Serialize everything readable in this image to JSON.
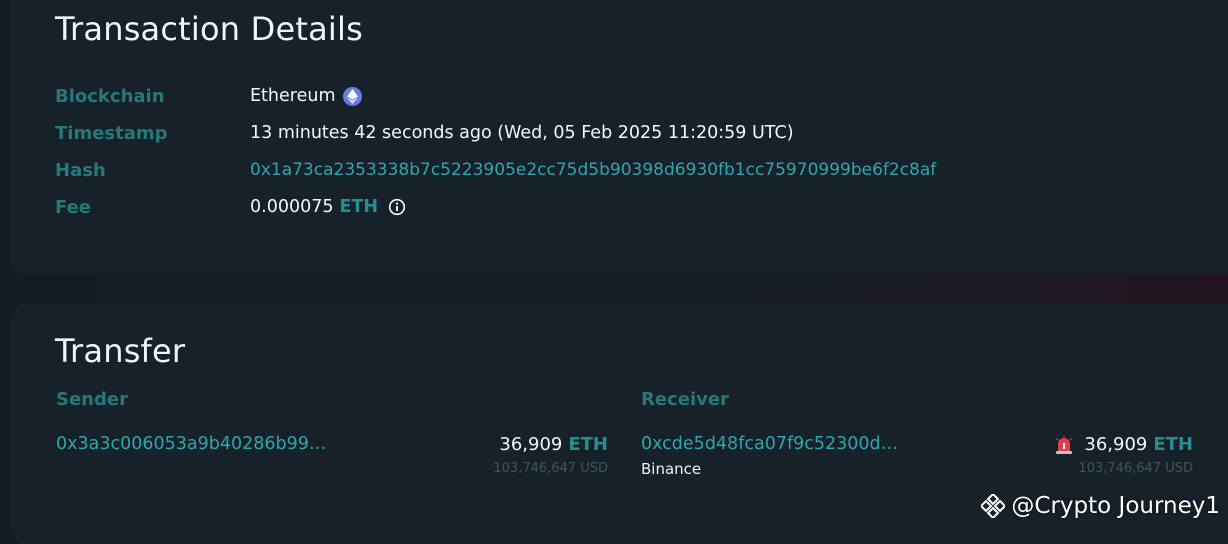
{
  "details": {
    "title": "Transaction Details",
    "rows": {
      "blockchain": {
        "label": "Blockchain",
        "value": "Ethereum",
        "icon": "ethereum-icon"
      },
      "timestamp": {
        "label": "Timestamp",
        "value": "13 minutes 42 seconds ago (Wed, 05 Feb 2025 11:20:59 UTC)"
      },
      "hash": {
        "label": "Hash",
        "value": "0x1a73ca2353338b7c5223905e2cc75d5b90398d6930fb1cc75970999be6f2c8af"
      },
      "fee": {
        "label": "Fee",
        "amount": "0.000075",
        "unit": "ETH",
        "icon": "info-icon"
      }
    }
  },
  "transfer": {
    "title": "Transfer",
    "sender": {
      "label": "Sender",
      "address": "0x3a3c006053a9b40286b99…",
      "amount": "36,909",
      "unit": "ETH",
      "usd": "103,746,647 USD"
    },
    "receiver": {
      "label": "Receiver",
      "address": "0xcde5d48fca07f9c52300d…",
      "entity": "Binance",
      "amount": "36,909",
      "unit": "ETH",
      "usd": "103,746,647 USD",
      "icon": "alarm-icon"
    }
  },
  "watermark": {
    "text": "@Crypto Journey1",
    "icon": "binance-logo-icon"
  },
  "colors": {
    "background": "#131c24",
    "card": "#17212a",
    "label_teal": "#27787a",
    "link_teal": "#2ca8ad",
    "ethereum": "#627eea",
    "alarm_red": "#e0404a"
  }
}
